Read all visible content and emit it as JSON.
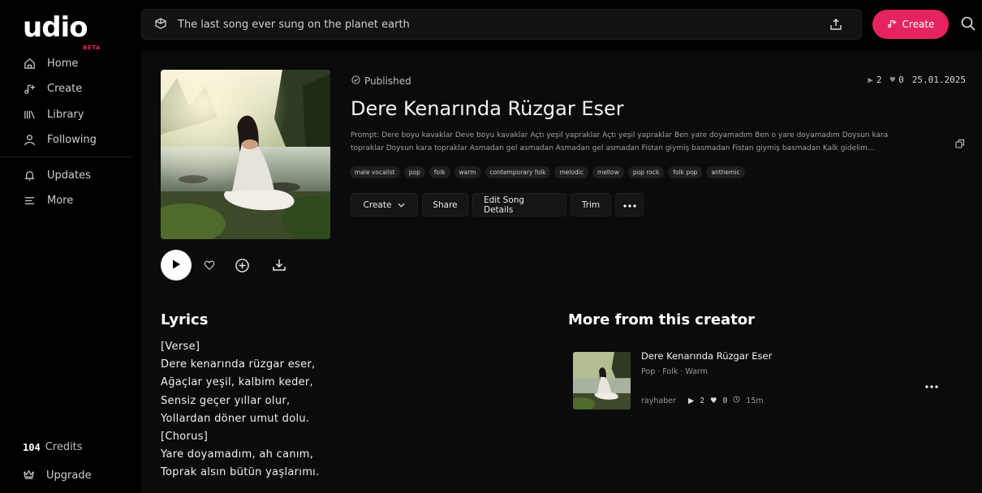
{
  "brand": {
    "logo_text": "udio",
    "badge": "BETA",
    "accent": "#e5245f"
  },
  "sidebar": {
    "items": [
      {
        "label": "Home",
        "icon": "home-icon"
      },
      {
        "label": "Create",
        "icon": "music-note-plus-icon"
      },
      {
        "label": "Library",
        "icon": "library-icon"
      },
      {
        "label": "Following",
        "icon": "person-icon"
      },
      {
        "label": "Updates",
        "icon": "bell-icon"
      },
      {
        "label": "More",
        "icon": "menu-lines-icon"
      }
    ],
    "credits_count": "104",
    "credits_label": "Credits",
    "upgrade_label": "Upgrade"
  },
  "topbar": {
    "prompt_value": "The last song ever sung on the planet earth",
    "create_label": "Create"
  },
  "song": {
    "status": "Published",
    "plays": "2",
    "likes": "0",
    "date": "25.01.2025",
    "title": "Dere Kenarında Rüzgar Eser",
    "prompt_line1": "Prompt: Dere boyu kavaklar Deve boyu kavaklar Açtı yeşil yapraklar Açtı yeşil yapraklar Ben yare doyamadım Ben o yare doyamadım Doysun kara",
    "prompt_line2": "topraklar Doysun kara topraklar Asmadan gel asmadan Asmadan gel asmadan Fistan giymiş basmadan Fistan giymiş basmadan Kalk gidelim...",
    "tags": [
      "male vocalist",
      "pop",
      "folk",
      "warm",
      "contemporary folk",
      "melodic",
      "mellow",
      "pop rock",
      "folk pop",
      "anthemic"
    ],
    "actions": {
      "create": "Create",
      "share": "Share",
      "edit": "Edit Song Details",
      "trim": "Trim"
    }
  },
  "lyrics": {
    "heading": "Lyrics",
    "lines": [
      "[Verse]",
      "Dere kenarında rüzgar eser,",
      "Ağaçlar yeşil, kalbim keder,",
      "Sensiz geçer yıllar olur,",
      "Yollardan döner umut dolu.",
      "[Chorus]",
      "Yare doyamadım, ah canım,",
      "Toprak alsın bütün yaşlarımı."
    ]
  },
  "more_from_creator": {
    "heading": "More from this creator",
    "track": {
      "title": "Dere Kenarında Rüzgar Eser",
      "genres": "Pop · Folk · Warm",
      "creator": "rayhaber",
      "plays": "2",
      "likes": "0",
      "duration": "15m"
    }
  }
}
